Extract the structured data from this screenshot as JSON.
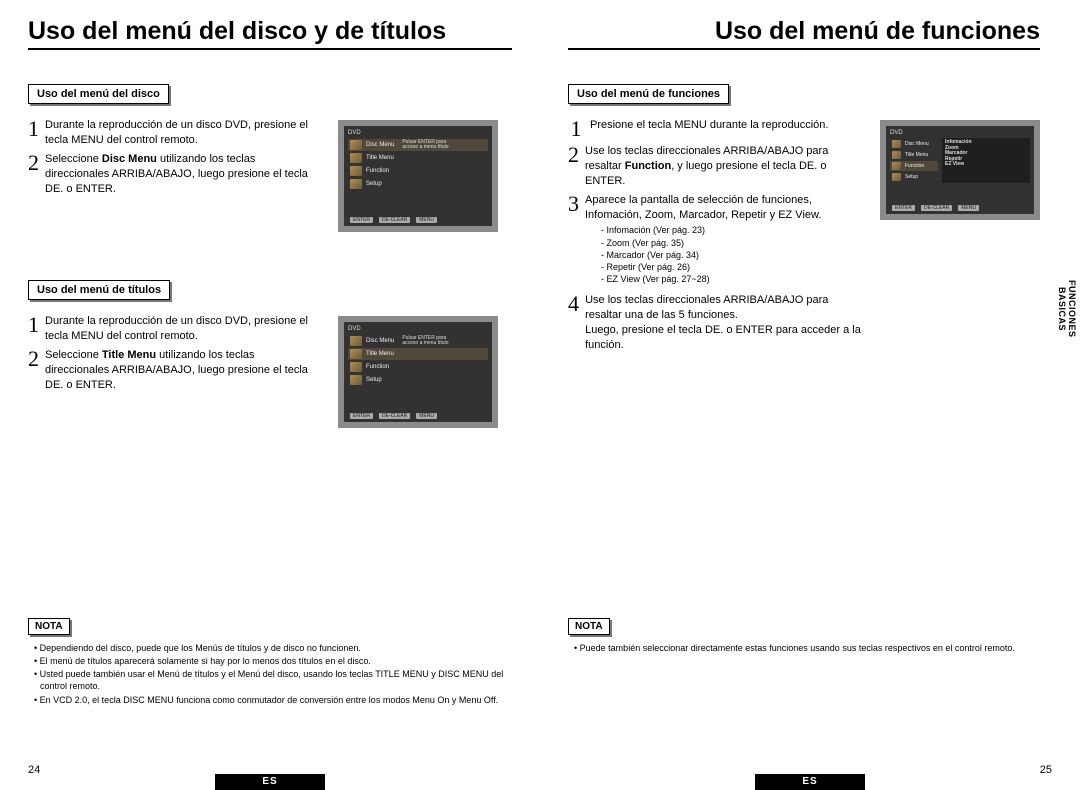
{
  "leftPage": {
    "title": "Uso del menú del disco y de títulos",
    "sectionA": {
      "chip": "Uso del menú del disco",
      "steps": {
        "s1": "Durante la reproducción de un disco DVD, presione el tecla MENU del control remoto.",
        "s2_pre": "Seleccione ",
        "s2_bold": "Disc Menu",
        "s2_post": " utilizando los teclas direccionales ARRIBA/ABAJO, luego presione el tecla DE. o ENTER."
      }
    },
    "sectionB": {
      "chip": "Uso del menú de títulos",
      "steps": {
        "s1": "Durante la reproducción de un disco DVD, presione el tecla MENU del control remoto.",
        "s2_pre": "Seleccione ",
        "s2_bold": "Title Menu",
        "s2_post": " utilizando los teclas direccionales ARRIBA/ABAJO, luego presione el tecla DE. o ENTER."
      }
    },
    "note": {
      "label": "NOTA",
      "items": [
        "Dependiendo del disco, puede que los Menús de títulos y de disco no funcionen.",
        "El menú de títulos aparecerá solamente si hay por lo menos dos títulos en el disco.",
        "Usted puede también usar el Menú de títulos y el Menú del disco, usando los teclas TITLE MENU y DISC MENU del control remoto.",
        "En VCD 2.0, el tecla DISC MENU funciona como conmutador de conversión entre los modos Menu On y Menu Off."
      ]
    },
    "pageNum": "24",
    "lang": "ES",
    "shot": {
      "dvd": "DVD",
      "rows": [
        "Disc Menu",
        "Title Menu",
        "Function",
        "Setup"
      ],
      "caption1": "Pulsar ENTER para",
      "caption2": "acceso a menu título",
      "buttons": [
        "ENTER",
        "DE-CLEAR",
        "MENU"
      ]
    }
  },
  "rightPage": {
    "title": "Uso del menú de funciones",
    "section": {
      "chip": "Uso del menú de funciones",
      "steps": {
        "s1": "Presione el tecla MENU durante la reproducción.",
        "s2_pre": "Use los teclas direccionales ARRIBA/ABAJO para resaltar ",
        "s2_bold": "Function",
        "s2_post": ", y luego presione el tecla DE. o ENTER.",
        "s3": "Aparece la pantalla de selección de funciones, Infomación, Zoom, Marcador, Repetir y EZ View.",
        "s3list": [
          "Infomación (Ver pág. 23)",
          "Zoom (Ver pág. 35)",
          "Marcador (Ver pág. 34)",
          "Repetir (Ver pág. 26)",
          "EZ View (Ver pág. 27~28)"
        ],
        "s4a": "Use los teclas direccionales ARRIBA/ABAJO para resaltar una de las 5 funciones.",
        "s4b": "Luego, presione el tecla DE. o ENTER para acceder a la función."
      }
    },
    "note": {
      "label": "NOTA",
      "items": [
        "Puede también seleccionar directamente estas funciones usando sus teclas respectivos en el control remoto."
      ]
    },
    "pageNum": "25",
    "lang": "ES",
    "sideTab1": "FUNCIONES",
    "sideTab2": "BASICAS",
    "shot": {
      "dvd": "DVD",
      "rows": [
        "Disc Menu",
        "Title Menu",
        "Function",
        "Setup"
      ],
      "funcs": [
        "Infomación",
        "Zoom",
        "Marcador",
        "Repetir",
        "EZ View"
      ],
      "buttons": [
        "ENTER",
        "DE-CLEAR",
        "MENU"
      ]
    }
  }
}
